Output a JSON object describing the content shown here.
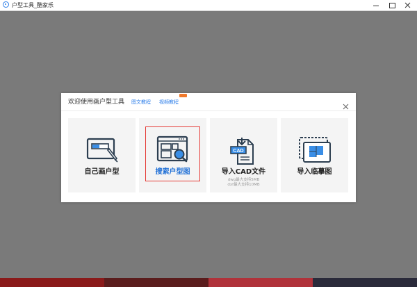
{
  "window": {
    "title": "户型工具_酷家乐",
    "icons": [
      "app-logo-icon",
      "minimize-icon",
      "maximize-icon",
      "close-icon"
    ]
  },
  "modal": {
    "title": "欢迎使用画户型工具",
    "links": {
      "image_tutorial": "图文教程",
      "video_tutorial": "视频教程"
    },
    "close_icon": "close-icon",
    "cards": [
      {
        "label": "自己画户型",
        "icon": "draw-floorplan-icon",
        "selected": false
      },
      {
        "label": "搜索户型图",
        "icon": "search-floorplan-icon",
        "selected": true
      },
      {
        "label": "导入CAD文件",
        "icon": "cad-file-icon",
        "sub_line1": "dwg最大支持5MB",
        "sub_line2": "dxf最大支持10MB",
        "selected": false
      },
      {
        "label": "导入临摹图",
        "icon": "trace-image-icon",
        "selected": false
      }
    ]
  },
  "colors": {
    "accent": "#2b7de9",
    "selected_border": "#e53935",
    "badge": "#f0792b",
    "overlay": "#7a7a7a"
  }
}
